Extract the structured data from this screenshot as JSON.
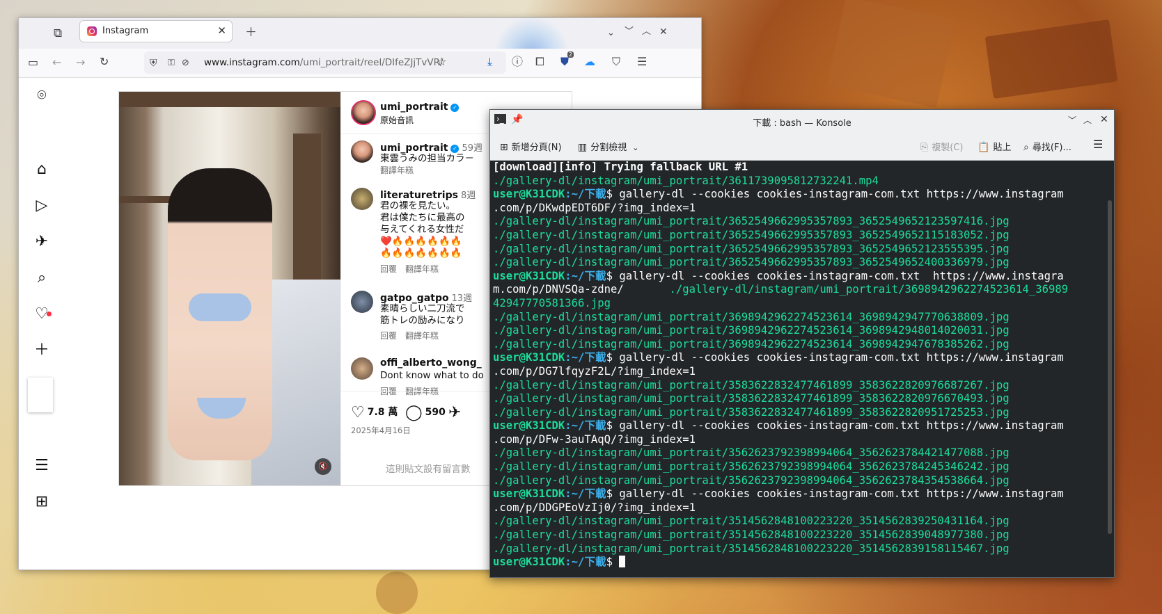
{
  "browser": {
    "tab_title": "Instagram",
    "url_host": "www.instagram.com",
    "url_path": "/umi_portrait/reel/DIfeZJjTvVR/",
    "extension_badge": "2"
  },
  "instagram": {
    "header": {
      "username": "umi_portrait",
      "subtitle": "原始音訊"
    },
    "comments": [
      {
        "name": "umi_portrait",
        "time": "59週",
        "lines": [
          "東雲うみの担当カラ－"
        ],
        "meta": [
          "翻譯年糕"
        ]
      },
      {
        "name": "literaturetrips",
        "time": "8週",
        "lines": [
          "君の裸を見たい。",
          "君は僕たちに最高の",
          "与えてくれる女性だ",
          "❤️🔥🔥🔥🔥🔥🔥",
          "🔥🔥🔥🔥🔥🔥🔥"
        ],
        "meta": [
          "回覆",
          "翻譯年糕"
        ]
      },
      {
        "name": "gatpo_gatpo",
        "time": "13週",
        "lines": [
          "素晴らしい二刀流で",
          "筋トレの励みになり"
        ],
        "meta": [
          "回覆",
          "翻譯年糕"
        ]
      },
      {
        "name": "offi_alberto_wong_",
        "time": "",
        "lines": [
          "Dont know what to do"
        ],
        "meta": [
          "回覆",
          "翻譯年糕"
        ]
      }
    ],
    "likes": "7.8 萬",
    "comments_count": "590",
    "date": "2025年4月16日",
    "no_comments_text": "這則貼文設有留言數"
  },
  "konsole": {
    "title": "下載 : bash — Konsole",
    "toolbar": {
      "new_tab": "新增分頁(N)",
      "split_view": "分割檢視",
      "copy": "複製(C)",
      "paste": "貼上",
      "find": "尋找(F)..."
    },
    "prompt_user": "user@K31CDK",
    "prompt_path": ":~/下載",
    "lines": [
      {
        "t": "bold",
        "text": "[download][info] Trying fallback URL #1"
      },
      {
        "t": "green",
        "text": "./gallery-dl/instagram/umi_portrait/3611739095812732241.mp4"
      },
      {
        "t": "prompt",
        "text": "$ gallery-dl --cookies cookies-instagram-com.txt https://www.instagram"
      },
      {
        "t": "white",
        "text": ".com/p/DKwdpEDT6DF/?img_index=1"
      },
      {
        "t": "green",
        "text": "./gallery-dl/instagram/umi_portrait/3652549662995357893_3652549652123597416.jpg"
      },
      {
        "t": "green",
        "text": "./gallery-dl/instagram/umi_portrait/3652549662995357893_3652549652115183052.jpg"
      },
      {
        "t": "green",
        "text": "./gallery-dl/instagram/umi_portrait/3652549662995357893_3652549652123555395.jpg"
      },
      {
        "t": "green",
        "text": "./gallery-dl/instagram/umi_portrait/3652549662995357893_3652549652400336979.jpg"
      },
      {
        "t": "prompt",
        "text": "$ gallery-dl --cookies cookies-instagram-com.txt  https://www.instagra"
      },
      {
        "t": "mixed",
        "text": "m.com/p/DNVSQa-zdne/",
        "green": "       ./gallery-dl/instagram/umi_portrait/3698942962274523614_36989"
      },
      {
        "t": "green",
        "text": "42947770581366.jpg"
      },
      {
        "t": "green",
        "text": "./gallery-dl/instagram/umi_portrait/3698942962274523614_3698942947770638809.jpg"
      },
      {
        "t": "green",
        "text": "./gallery-dl/instagram/umi_portrait/3698942962274523614_3698942948014020031.jpg"
      },
      {
        "t": "green",
        "text": "./gallery-dl/instagram/umi_portrait/3698942962274523614_3698942947678385262.jpg"
      },
      {
        "t": "prompt",
        "text": "$ gallery-dl --cookies cookies-instagram-com.txt https://www.instagram"
      },
      {
        "t": "white",
        "text": ".com/p/DG7lfqyzF2L/?img_index=1"
      },
      {
        "t": "green",
        "text": "./gallery-dl/instagram/umi_portrait/3583622832477461899_3583622820976687267.jpg"
      },
      {
        "t": "green",
        "text": "./gallery-dl/instagram/umi_portrait/3583622832477461899_3583622820976670493.jpg"
      },
      {
        "t": "green",
        "text": "./gallery-dl/instagram/umi_portrait/3583622832477461899_3583622820951725253.jpg"
      },
      {
        "t": "prompt",
        "text": "$ gallery-dl --cookies cookies-instagram-com.txt https://www.instagram"
      },
      {
        "t": "white",
        "text": ".com/p/DFw-3auTAqQ/?img_index=1"
      },
      {
        "t": "green",
        "text": "./gallery-dl/instagram/umi_portrait/3562623792398994064_3562623784421477088.jpg"
      },
      {
        "t": "green",
        "text": "./gallery-dl/instagram/umi_portrait/3562623792398994064_3562623784245346242.jpg"
      },
      {
        "t": "green",
        "text": "./gallery-dl/instagram/umi_portrait/3562623792398994064_3562623784354538664.jpg"
      },
      {
        "t": "prompt",
        "text": "$ gallery-dl --cookies cookies-instagram-com.txt https://www.instagram"
      },
      {
        "t": "white",
        "text": ".com/p/DDGPEoVzIj0/?img_index=1"
      },
      {
        "t": "green",
        "text": "./gallery-dl/instagram/umi_portrait/3514562848100223220_3514562839250431164.jpg"
      },
      {
        "t": "green",
        "text": "./gallery-dl/instagram/umi_portrait/3514562848100223220_3514562839048977380.jpg"
      },
      {
        "t": "green",
        "text": "./gallery-dl/instagram/umi_portrait/3514562848100223220_3514562839158115467.jpg"
      },
      {
        "t": "cursor",
        "text": "$ "
      }
    ]
  }
}
